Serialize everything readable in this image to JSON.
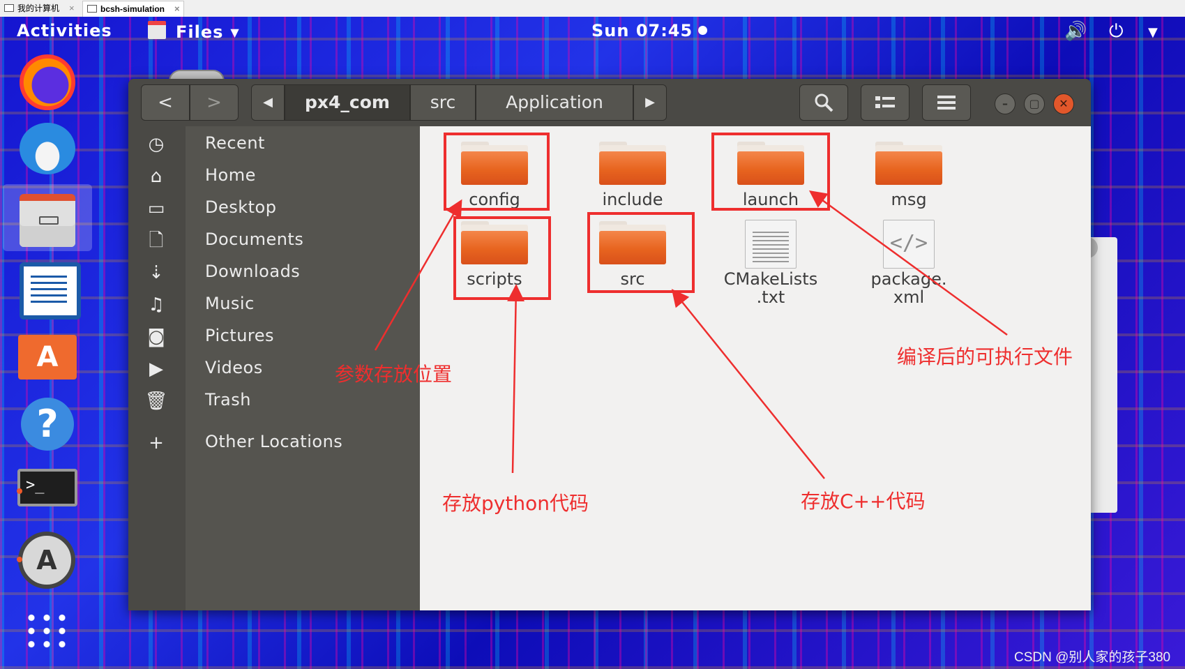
{
  "vm_tabs": [
    {
      "label": "我的计算机"
    },
    {
      "label": "bcsh-simulation"
    }
  ],
  "topbar": {
    "activities": "Activities",
    "app_menu": "Files",
    "clock": "Sun 07:45"
  },
  "dock": {
    "items": [
      "firefox",
      "thunderbird",
      "files",
      "libreoffice-writer",
      "ubuntu-software",
      "help",
      "terminal",
      "software-updater",
      "show-applications"
    ]
  },
  "headerbar": {
    "path": [
      "px4_com",
      "src",
      "Application"
    ],
    "icons": {
      "back": "chevron-left",
      "forward": "chevron-right",
      "search": "search",
      "view": "list-view",
      "menu": "hamburger"
    }
  },
  "sidebar": {
    "items": [
      {
        "label": "Recent",
        "icon": "clock"
      },
      {
        "label": "Home",
        "icon": "home"
      },
      {
        "label": "Desktop",
        "icon": "folder"
      },
      {
        "label": "Documents",
        "icon": "document"
      },
      {
        "label": "Downloads",
        "icon": "download"
      },
      {
        "label": "Music",
        "icon": "music"
      },
      {
        "label": "Pictures",
        "icon": "camera"
      },
      {
        "label": "Videos",
        "icon": "video"
      },
      {
        "label": "Trash",
        "icon": "trash"
      },
      {
        "label": "Other Locations",
        "icon": "plus"
      }
    ]
  },
  "files": [
    {
      "name": "config",
      "type": "folder"
    },
    {
      "name": "include",
      "type": "folder"
    },
    {
      "name": "launch",
      "type": "folder"
    },
    {
      "name": "msg",
      "type": "folder"
    },
    {
      "name": "scripts",
      "type": "folder"
    },
    {
      "name": "src",
      "type": "folder"
    },
    {
      "name_line1": "CMakeLists",
      "name_line2": ".txt",
      "type": "text"
    },
    {
      "name_line1": "package.",
      "name_line2": "xml",
      "type": "xml"
    }
  ],
  "annotations": {
    "params": "参数存放位置",
    "python": "存放python代码",
    "cpp": "存放C++代码",
    "executable": "编译后的可执行文件",
    "color": "#ee2e2e"
  },
  "watermark": "CSDN @别人家的孩子380"
}
